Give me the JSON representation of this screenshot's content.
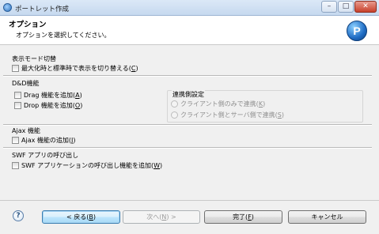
{
  "window": {
    "title": "ポートレット作成",
    "minimize": "–",
    "maximize": "□",
    "close": "✕"
  },
  "header": {
    "title": "オプション",
    "description": "オプションを選択してください。",
    "logo_letter": "P"
  },
  "sections": {
    "display_mode": {
      "label": "表示モード切替",
      "option_prefix": "最大化時と標準時で表示を切り替える(",
      "option_mnemonic": "C",
      "option_suffix": ")",
      "checked": false
    },
    "dnd": {
      "label": "D&D機能",
      "drag_prefix": "Drag 機能を追加(",
      "drag_mnemonic": "A",
      "drag_suffix": ")",
      "drop_prefix": "Drop 機能を追加(",
      "drop_mnemonic": "O",
      "drop_suffix": ")",
      "drag_checked": false,
      "drop_checked": false,
      "link_side": {
        "legend": "連携側設定",
        "client_only_prefix": "クライアント側のみで連携(",
        "client_only_mnemonic": "K",
        "client_only_suffix": ")",
        "client_server_prefix": "クライアント側とサーバ側で連携(",
        "client_server_mnemonic": "S",
        "client_server_suffix": ")"
      }
    },
    "ajax": {
      "label": "Ajax 機能",
      "option_prefix": "Ajax 機能の追加(",
      "option_mnemonic": "J",
      "option_suffix": ")",
      "checked": false
    },
    "swf": {
      "label": "SWF アプリの呼び出し",
      "option_prefix": "SWF アプリケーションの呼び出し機能を追加(",
      "option_mnemonic": "W",
      "option_suffix": ")",
      "checked": false
    }
  },
  "footer": {
    "help_icon": "?",
    "back_prefix": "< 戻る(",
    "back_mnemonic": "B",
    "back_suffix": ")",
    "next_prefix": "次へ(",
    "next_mnemonic": "N",
    "next_suffix": ") >",
    "finish_prefix": "完了(",
    "finish_mnemonic": "F",
    "finish_suffix": ")",
    "cancel_label": "キャンセル"
  }
}
